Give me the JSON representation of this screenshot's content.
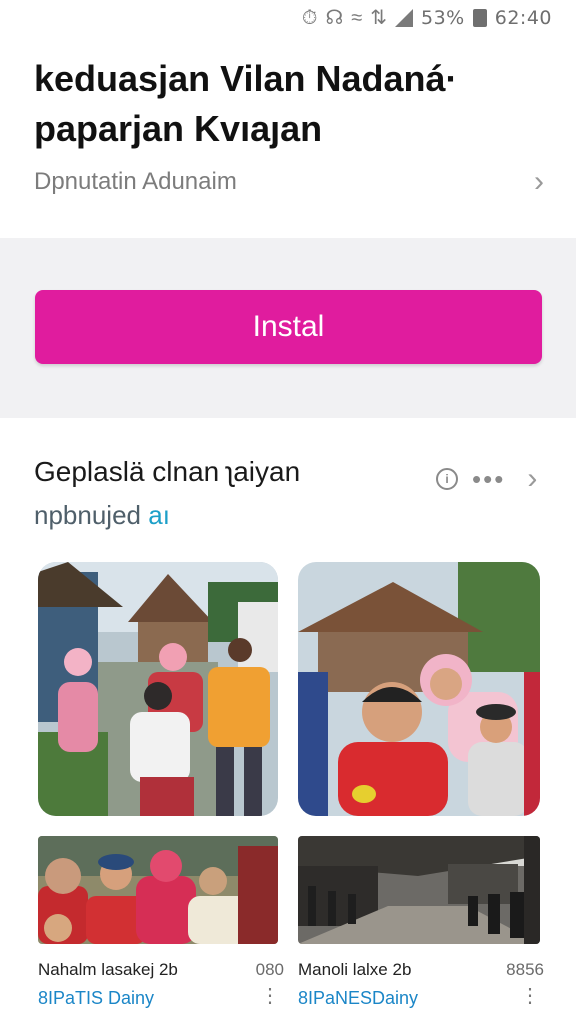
{
  "status_bar": {
    "icons": [
      "alarm-icon",
      "vibrate-icon",
      "wifi-icon",
      "data-icon",
      "signal-icon",
      "battery-icon"
    ],
    "battery": "53%",
    "time": "62:40"
  },
  "header": {
    "title_line1": "keduasjan Vilan Nadaná·",
    "title_line2": "paparjan Kvıaȷan",
    "subtitle": "Dpnutatin Adunaim"
  },
  "install": {
    "label": "Instal",
    "color": "#e01c9e"
  },
  "section": {
    "title": "Geplaslä clnan ʅaiyan",
    "subtitle_main": "npbnujed ",
    "subtitle_accent": "aı"
  },
  "cards": [
    {
      "name": "Nahalm lasakej 2b",
      "count": "080",
      "tag": "8IPaTIS Dainy"
    },
    {
      "name": "Manoli lalxe 2b",
      "count": "8856",
      "tag": "8IPaNESDainy"
    }
  ]
}
